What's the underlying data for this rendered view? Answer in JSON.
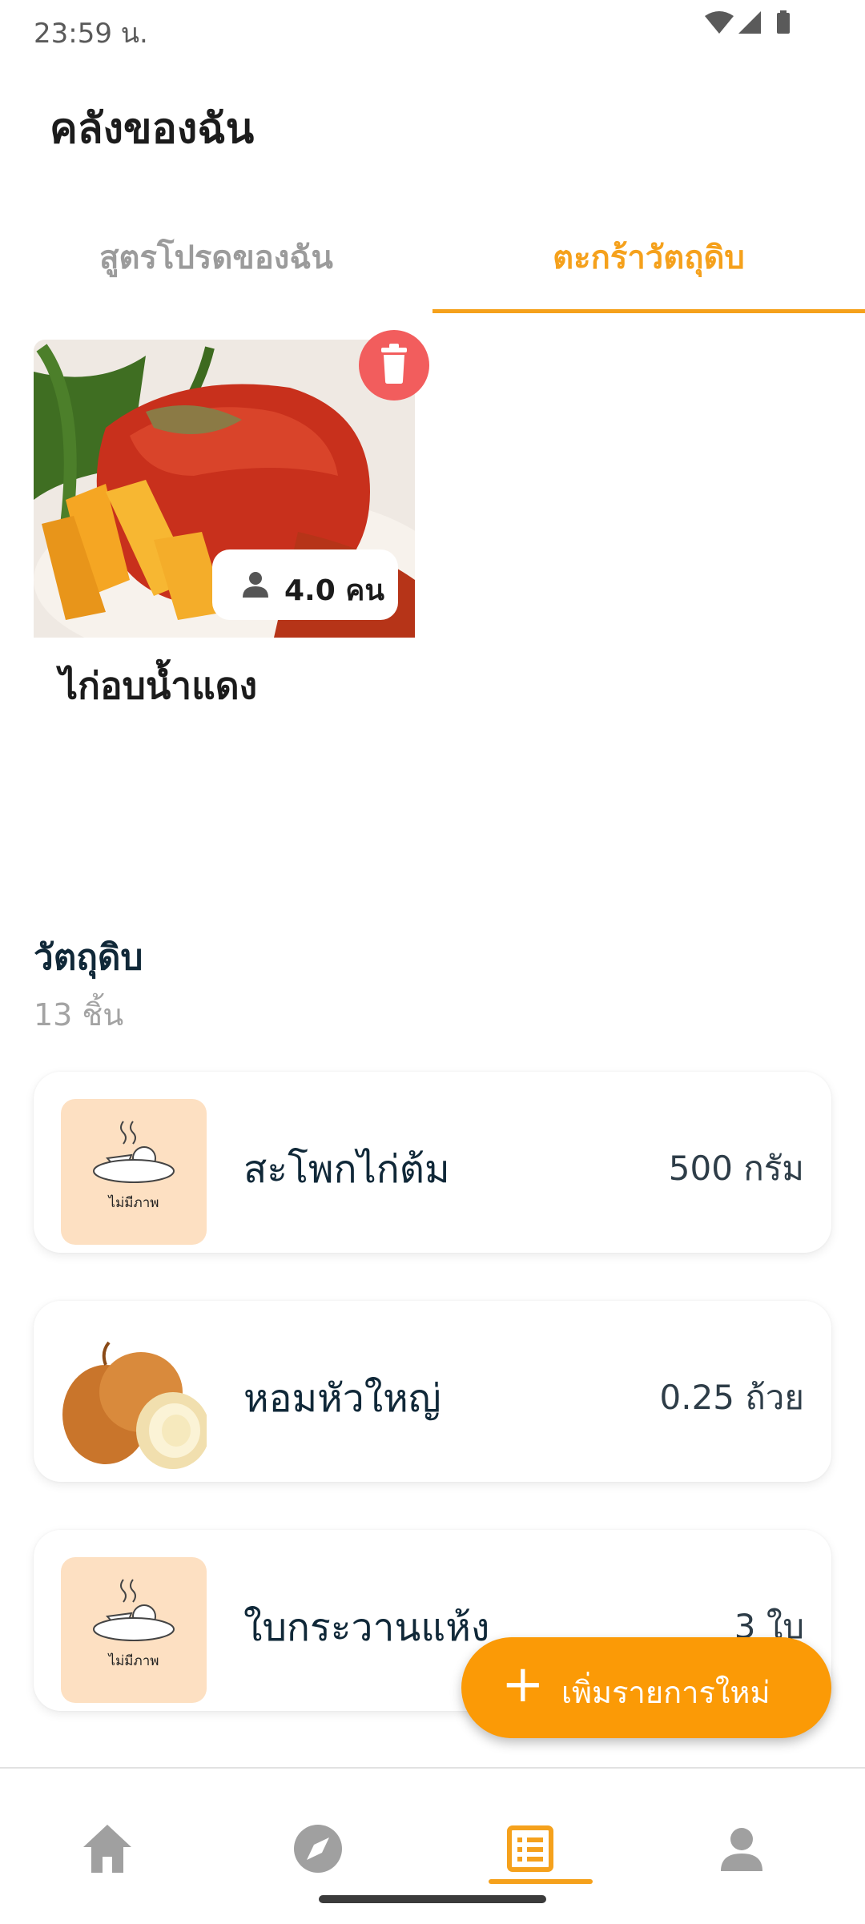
{
  "status_bar": {
    "time": "23:59 น."
  },
  "header": {
    "title": "คลังของฉัน"
  },
  "tabs": [
    {
      "label": "สูตรโปรดของฉัน",
      "active": false
    },
    {
      "label": "ตะกร้าวัตถุดิบ",
      "active": true
    }
  ],
  "recipe": {
    "name": "ไก่อบน้ำแดง",
    "servings": "4.0 คน"
  },
  "ingredients": {
    "heading": "วัตถุดิบ",
    "count": "13 ชิ้น",
    "no_image_caption": "ไม่มีภาพ",
    "items": [
      {
        "name": "สะโพกไก่ต้ม",
        "qty": "500 กรัม",
        "image": "placeholder"
      },
      {
        "name": "หอมหัวใหญ่",
        "qty": "0.25 ถ้วย",
        "image": "onion"
      },
      {
        "name": "ใบกระวานแห้ง",
        "qty": "3 ใบ",
        "image": "placeholder"
      }
    ]
  },
  "fab": {
    "label": "เพิ่มรายการใหม่"
  },
  "nav": [
    {
      "icon": "home-icon",
      "active": false
    },
    {
      "icon": "compass-icon",
      "active": false
    },
    {
      "icon": "list-icon",
      "active": true
    },
    {
      "icon": "person-icon",
      "active": false
    }
  ],
  "colors": {
    "accent": "#f5a11c",
    "fab": "#fb9a06",
    "delete": "#f25d5d",
    "placeholder_bg": "#fde0c2"
  }
}
